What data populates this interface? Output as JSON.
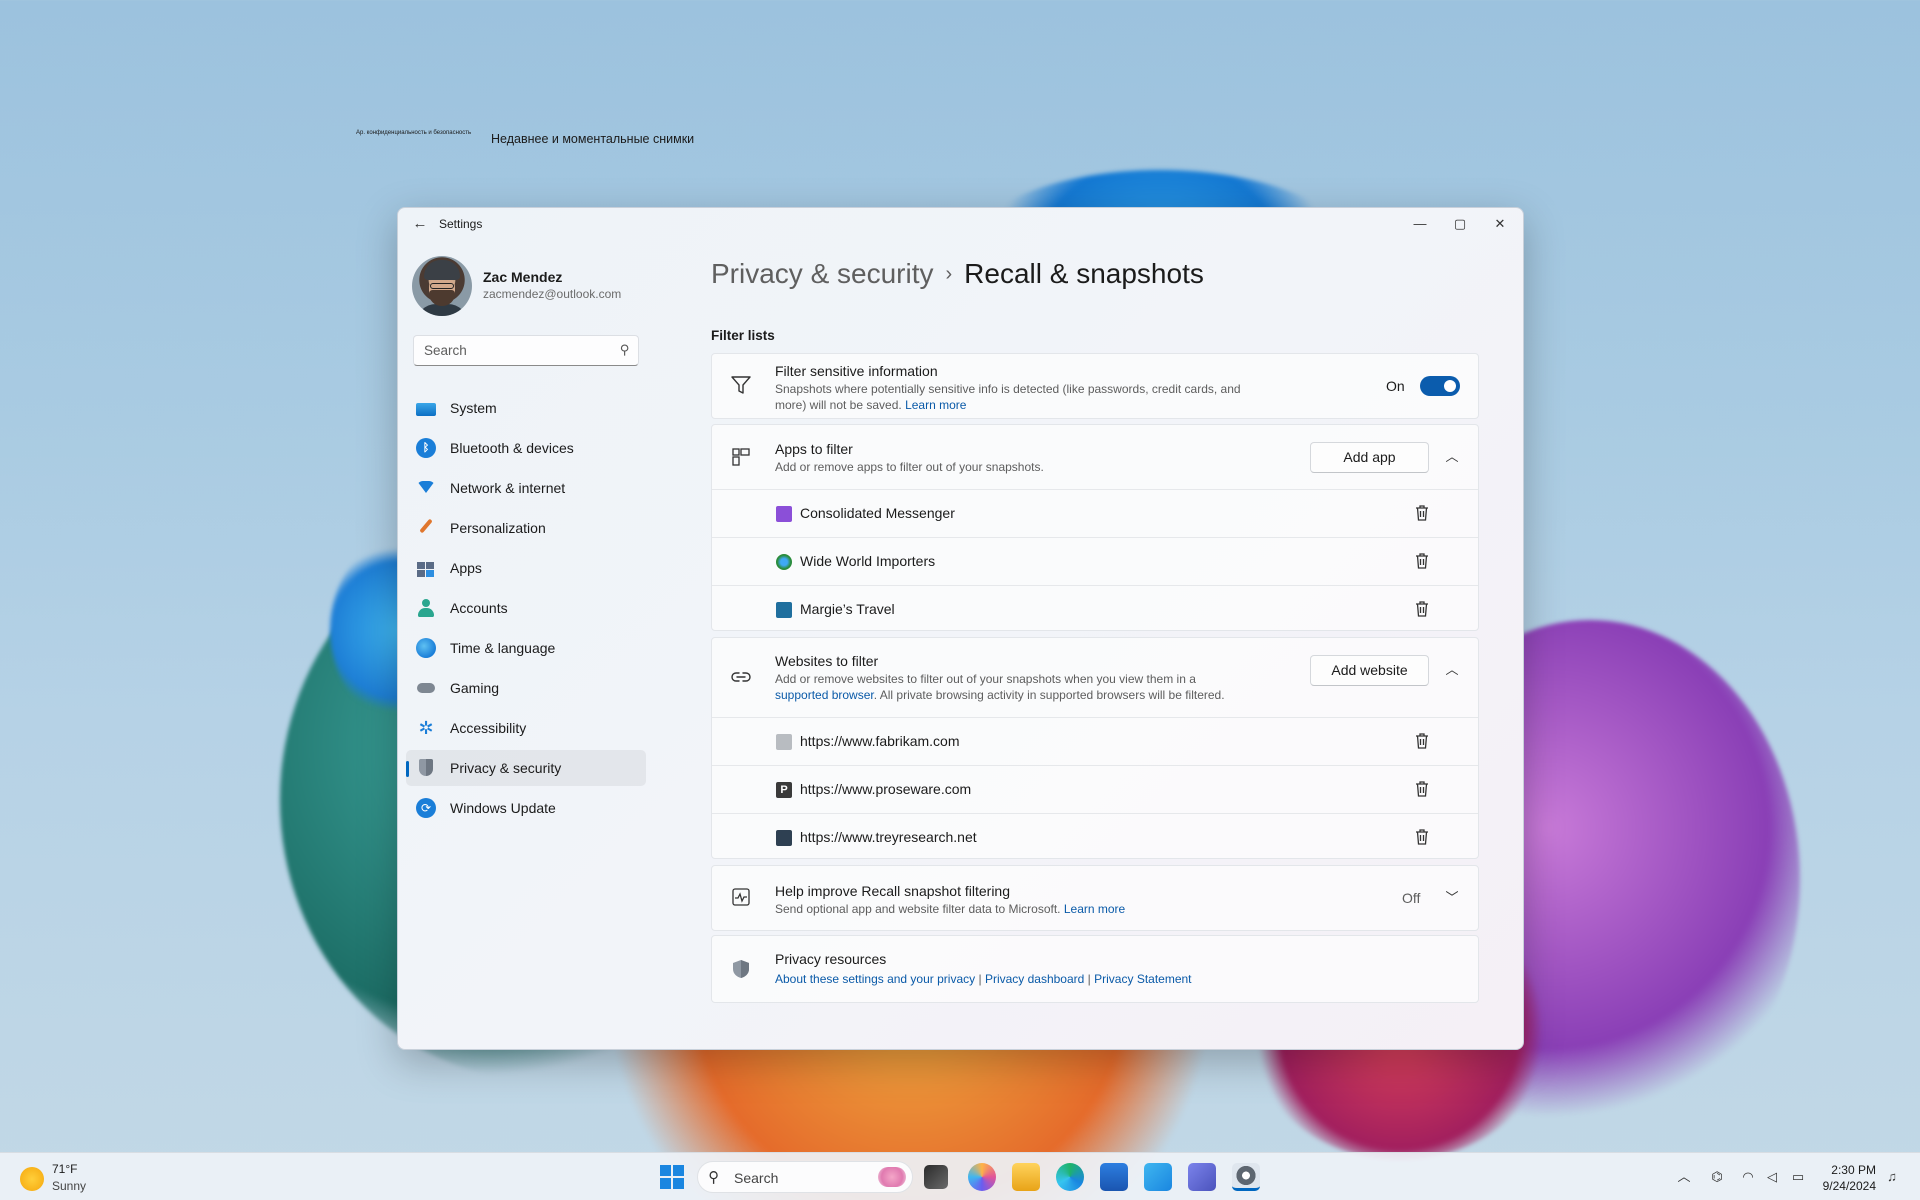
{
  "desktop": {
    "caption_small": "Ар. конфиденциальность и безопасность",
    "caption": "Недавнее и моментальные снимки"
  },
  "window": {
    "title": "Settings",
    "back_glyph": "←",
    "minimize_glyph": "—",
    "maximize_glyph": "▢",
    "close_glyph": "✕"
  },
  "profile": {
    "name": "Zac Mendez",
    "email": "zacmendez@outlook.com"
  },
  "sidebar": {
    "search_placeholder": "Search",
    "items": [
      {
        "label": "System",
        "icon": "system-icon"
      },
      {
        "label": "Bluetooth & devices",
        "icon": "bluetooth-icon"
      },
      {
        "label": "Network & internet",
        "icon": "wifi-icon"
      },
      {
        "label": "Personalization",
        "icon": "brush-icon"
      },
      {
        "label": "Apps",
        "icon": "apps-icon"
      },
      {
        "label": "Accounts",
        "icon": "person-icon"
      },
      {
        "label": "Time & language",
        "icon": "globe-clock-icon"
      },
      {
        "label": "Gaming",
        "icon": "gamepad-icon"
      },
      {
        "label": "Accessibility",
        "icon": "accessibility-icon"
      },
      {
        "label": "Privacy & security",
        "icon": "shield-icon",
        "active": true
      },
      {
        "label": "Windows Update",
        "icon": "update-icon"
      }
    ]
  },
  "breadcrumb": {
    "parent": "Privacy & security",
    "separator": "›",
    "current": "Recall & snapshots"
  },
  "filter_lists": {
    "section_title": "Filter lists",
    "sensitive": {
      "title": "Filter sensitive information",
      "desc": "Snapshots where potentially sensitive info is detected (like passwords, credit cards, and more) will not be saved.",
      "learn_more": "Learn more",
      "toggle_state": "On",
      "toggle_on": true
    },
    "apps": {
      "title": "Apps to filter",
      "desc": "Add or remove apps to filter out of your snapshots.",
      "add_button": "Add app",
      "items": [
        {
          "label": "Consolidated Messenger",
          "color": "#8b4fd8"
        },
        {
          "label": "Wide World Importers",
          "color": "#2a8c3a"
        },
        {
          "label": "Margie’s Travel",
          "color": "#1f6f9e"
        }
      ]
    },
    "websites": {
      "title": "Websites to filter",
      "desc_part1": "Add or remove websites to filter out of your snapshots when you view them in a",
      "desc_link": "supported browser",
      "desc_part2": ". All private browsing activity in supported browsers will be filtered.",
      "add_button": "Add website",
      "items": [
        {
          "label": "https://www.fabrikam.com",
          "color": "#9aa0a6"
        },
        {
          "label": "https://www.proseware.com",
          "color": "#3a3a3a"
        },
        {
          "label": "https://www.treyresearch.net",
          "color": "#2e4052"
        }
      ]
    },
    "help": {
      "title": "Help improve Recall snapshot filtering",
      "desc": "Send optional app and website filter data to Microsoft.",
      "learn_more": "Learn more",
      "state": "Off"
    },
    "resources": {
      "title": "Privacy resources",
      "link1": "About these settings and your privacy",
      "divider": "|",
      "link2": "Privacy dashboard",
      "link3": "Privacy Statement"
    }
  },
  "taskbar": {
    "weather_temp": "71°F",
    "weather_desc": "Sunny",
    "search_placeholder": "Search",
    "time": "2:30 PM",
    "date": "9/24/2024"
  }
}
